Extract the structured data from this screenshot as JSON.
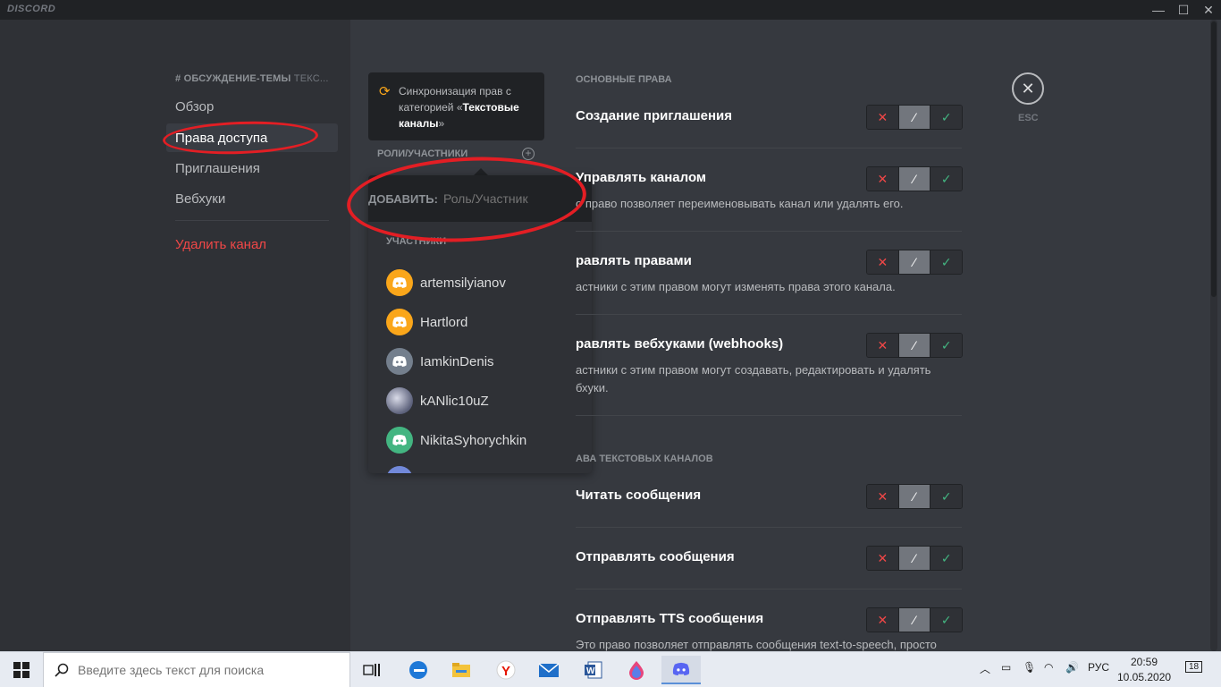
{
  "app": {
    "logo": "DISCORD"
  },
  "window_controls": {
    "minimize": "—",
    "maximize": "☐",
    "close": "✕"
  },
  "sidebar": {
    "header_hash": "#",
    "header_title": "ОБСУЖДЕНИЕ-ТЕМЫ",
    "header_tail": "ТЕКС...",
    "items": [
      {
        "label": "Обзор"
      },
      {
        "label": "Права доступа"
      },
      {
        "label": "Приглашения"
      },
      {
        "label": "Вебхуки"
      }
    ],
    "delete_label": "Удалить канал"
  },
  "sync": {
    "icon": "sync-icon",
    "text_before": "Синхронизация прав с категорией «",
    "text_bold": "Текстовые каналы",
    "text_after": "»"
  },
  "roles": {
    "label": "РОЛИ/УЧАСТНИКИ",
    "add_glyph": "+"
  },
  "popout": {
    "add_label": "ДОБАВИТЬ:",
    "placeholder": "Роль/Участник",
    "section_label": "УЧАСТНИКИ",
    "members": [
      {
        "name": "artemsilyianov",
        "color": "#faa61a"
      },
      {
        "name": "Hartlord",
        "color": "#faa61a"
      },
      {
        "name": "IamkinDenis",
        "color": "#747f8d"
      },
      {
        "name": "kANlic10uZ",
        "color": "#8a8fa8"
      },
      {
        "name": "NikitaSyhorychkin",
        "color": "#43b581"
      }
    ]
  },
  "permissions": {
    "section_general": "ОСНОВНЫЕ ПРАВА",
    "section_text": "АВА ТЕКСТОВЫХ КАНАЛОВ",
    "items": [
      {
        "title": "Создание приглашения",
        "desc": ""
      },
      {
        "title": "Управлять каналом",
        "desc": "о право позволяет переименовывать канал или удалять его."
      },
      {
        "title": "равлять правами",
        "desc": "астники с этим правом могут изменять права этого канала."
      },
      {
        "title": "равлять вебхуками (webhooks)",
        "desc": "астники с этим правом могут создавать, редактировать и удалять\nбхуки."
      },
      {
        "title": "Читать сообщения",
        "desc": ""
      },
      {
        "title": "Отправлять сообщения",
        "desc": ""
      },
      {
        "title": "Отправлять TTS сообщения",
        "desc": "Это право позволяет отправлять сообщения text-to-speech, просто"
      }
    ],
    "toggle": {
      "deny": "✕",
      "neutral": "⁄",
      "allow": "✓"
    }
  },
  "esc": {
    "glyph": "✕",
    "label": "ESC"
  },
  "taskbar": {
    "search_placeholder": "Введите здесь текст для поиска",
    "lang": "РУС",
    "time": "20:59",
    "date": "10.05.2020",
    "notifications": "18"
  },
  "colors": {
    "accent_red": "#e31e24",
    "deny": "#f04747",
    "allow": "#43b581",
    "sync": "#faa61a"
  }
}
